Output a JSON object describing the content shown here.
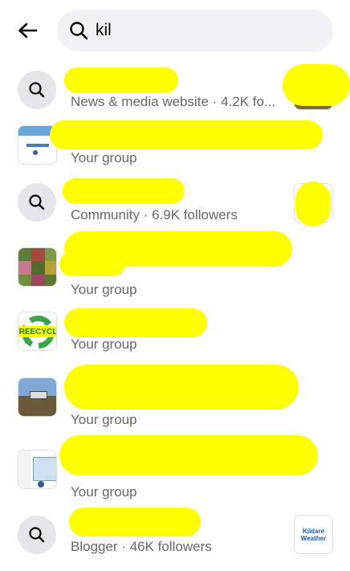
{
  "search": {
    "query": "kil"
  },
  "results": [
    {
      "title": "",
      "subtitle": "News & media website · 4.2K fo...",
      "type": "search"
    },
    {
      "title": "",
      "subtitle": "Your group",
      "type": "group"
    },
    {
      "title": "",
      "subtitle": "Community · 6.9K followers",
      "type": "search"
    },
    {
      "title": "",
      "subtitle": "Your group",
      "type": "group"
    },
    {
      "title": "",
      "subtitle": "Your group",
      "type": "group",
      "thumb_text": "REECYCL"
    },
    {
      "title": "",
      "subtitle": "Your group",
      "type": "group"
    },
    {
      "title": "",
      "subtitle": "Your group",
      "type": "group"
    },
    {
      "title": "",
      "subtitle": "Blogger · 46K followers",
      "type": "search",
      "right_thumb_text": [
        "Kildare",
        "Weather"
      ]
    }
  ],
  "colors": {
    "highlight": "#ffff00",
    "secondary_text": "#65676b",
    "search_bg": "#f0f2f5"
  }
}
